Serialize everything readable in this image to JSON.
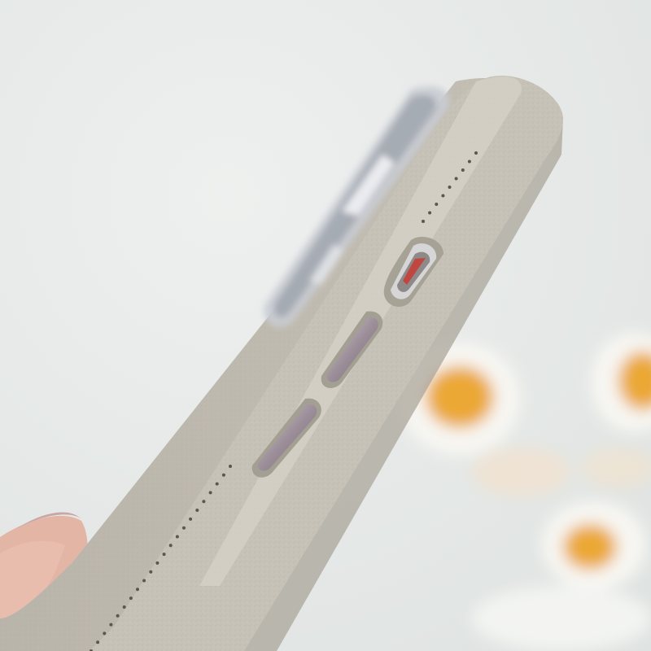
{
  "photo": {
    "subject": "leather-phone-case-side-view",
    "colors": {
      "background": "#e9ecea",
      "case_leather": "#bdb8ad",
      "case_edge": "#cbc6bb",
      "case_shadow": "#a6a195",
      "button_metal": "#9d8f99",
      "button_highlight": "#d6ccd3",
      "switch_red": "#c0473f",
      "flower_petal": "#f7f6f2",
      "flower_center": "#eba836",
      "skin": "#e3b5a4",
      "nail": "#c9a7a7",
      "camera_lens": "#c9ccd3"
    }
  }
}
